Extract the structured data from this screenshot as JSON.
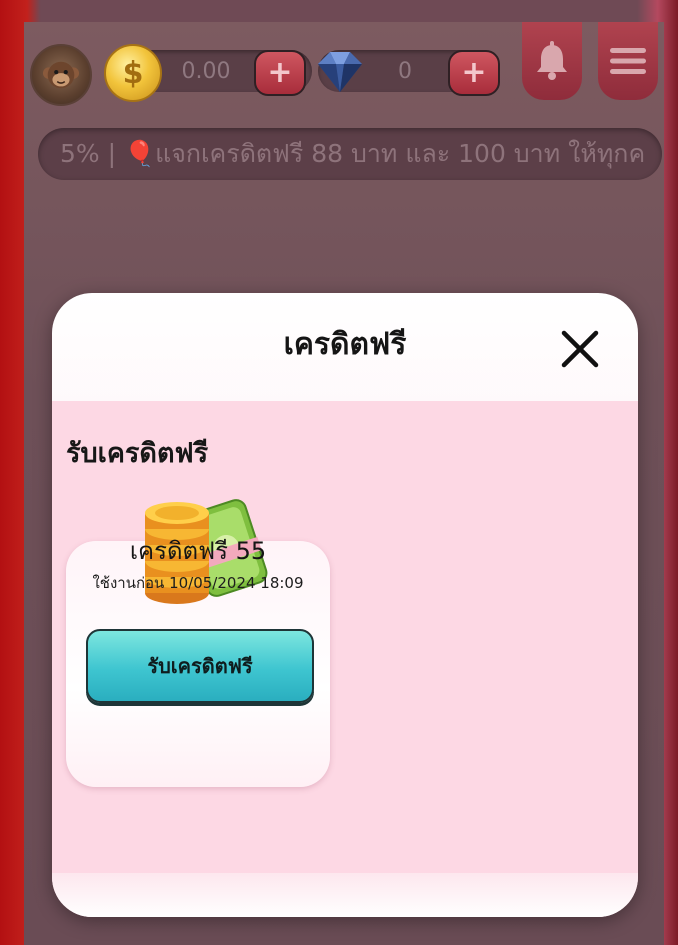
{
  "header": {
    "coin_balance": "0.00",
    "gem_balance": "0",
    "plus_label": "+",
    "coin_symbol": "$"
  },
  "marquee": {
    "text": "5% | 🎈แจกเครดิตฟรี 88 บาท และ 100 บาท ให้ทุกค"
  },
  "modal": {
    "title": "เครดิตฟรี",
    "section_title": "รับเครดิตฟรี",
    "card": {
      "title": "เครดิตฟรี 55",
      "expiry": "ใช้งานก่อน 10/05/2024 18:09",
      "claim_label": "รับเครดิตฟรี"
    }
  },
  "icons": {
    "avatar": "monkey-avatar-icon",
    "coin": "coin-icon",
    "gem": "gem-icon",
    "bell": "bell-icon",
    "menu": "hamburger-menu-icon",
    "close": "close-icon",
    "reward": "coins-and-cash-icon"
  },
  "colors": {
    "modal_body": "#fdd8e4",
    "claim_button": "#3ec5d0",
    "header_button": "#a82d3b"
  }
}
